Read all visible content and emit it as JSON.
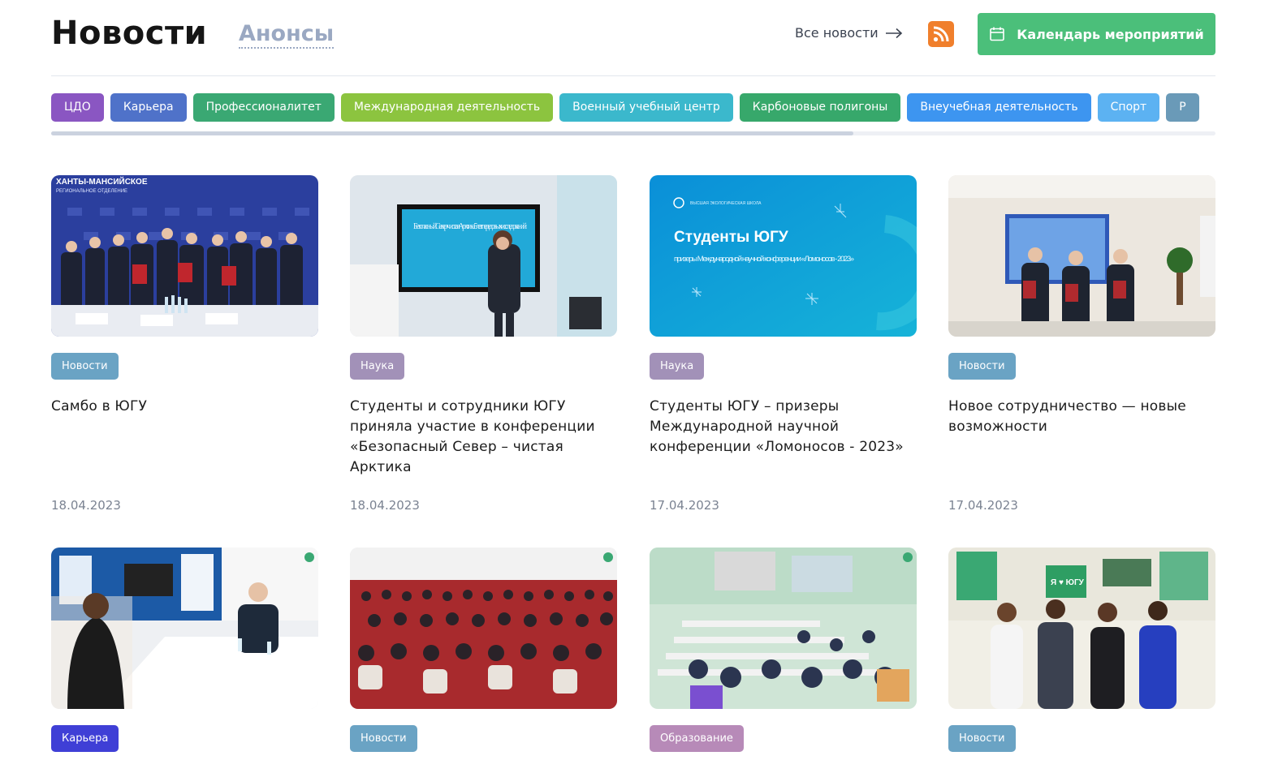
{
  "header": {
    "title": "Новости",
    "tab_announcements": "Анонсы",
    "all_news": "Все новости",
    "calendar_button": "Календарь мероприятий",
    "rss_icon": "rss-icon",
    "calendar_icon": "calendar-icon",
    "arrow_icon": "arrow-right-icon"
  },
  "categories": [
    {
      "label": "ЦДО",
      "color": "#8a56c2"
    },
    {
      "label": "Карьера",
      "color": "#4f72c9"
    },
    {
      "label": "Профессионалитет",
      "color": "#3aa873"
    },
    {
      "label": "Международная деятельность",
      "color": "#8cc43f"
    },
    {
      "label": "Военный учебный центр",
      "color": "#3bb8cc"
    },
    {
      "label": "Карбоновые полигоны",
      "color": "#37a86b"
    },
    {
      "label": "Внеучебная деятельность",
      "color": "#3d95f0"
    },
    {
      "label": "Спорт",
      "color": "#5cb2f2"
    },
    {
      "label": "Р",
      "color": "#6a9ab8"
    }
  ],
  "news": [
    {
      "tag": "Новости",
      "tag_color": "#6aa3c4",
      "title": "Самбо в ЮГУ",
      "date": "18.04.2023"
    },
    {
      "tag": "Наука",
      "tag_color": "#a291b8",
      "title": "Студенты и сотрудники ЮГУ приняла участие в конференции «Безопасный Север – чистая Арктика",
      "date": "18.04.2023"
    },
    {
      "tag": "Наука",
      "tag_color": "#a291b8",
      "title": "Студенты ЮГУ – призеры Международной научной конференции «Ломоносов - 2023»",
      "date": "17.04.2023"
    },
    {
      "tag": "Новости",
      "tag_color": "#6aa3c4",
      "title": "Новое сотрудничество — новые возможности",
      "date": "17.04.2023"
    },
    {
      "tag": "Карьера",
      "tag_color": "#3f3fd6",
      "title": "",
      "date": ""
    },
    {
      "tag": "Новости",
      "tag_color": "#6aa3c4",
      "title": "",
      "date": ""
    },
    {
      "tag": "Образование",
      "tag_color": "#b78ab8",
      "title": "",
      "date": ""
    },
    {
      "tag": "Новости",
      "tag_color": "#6aa3c4",
      "title": "",
      "date": ""
    }
  ],
  "image_texts": {
    "banner_region": "ХАНТЫ-МАНСИЙСКОЕ",
    "banner_region_sub": "РЕГИОНАЛЬНОЕ ОТДЕЛЕНИЕ",
    "screen_text": "Безопасный Север - чистая Арктика 5 лет передовых исследований",
    "promo_school": "ВЫСШАЯ ЭКОЛОГИЧЕСКАЯ ШКОЛА",
    "promo_title": "Студенты ЮГУ",
    "promo_sub": "призеры Международной научной конференции «Ломоносов - 2023»",
    "sign_text": "Я ♥ ЮГУ"
  }
}
